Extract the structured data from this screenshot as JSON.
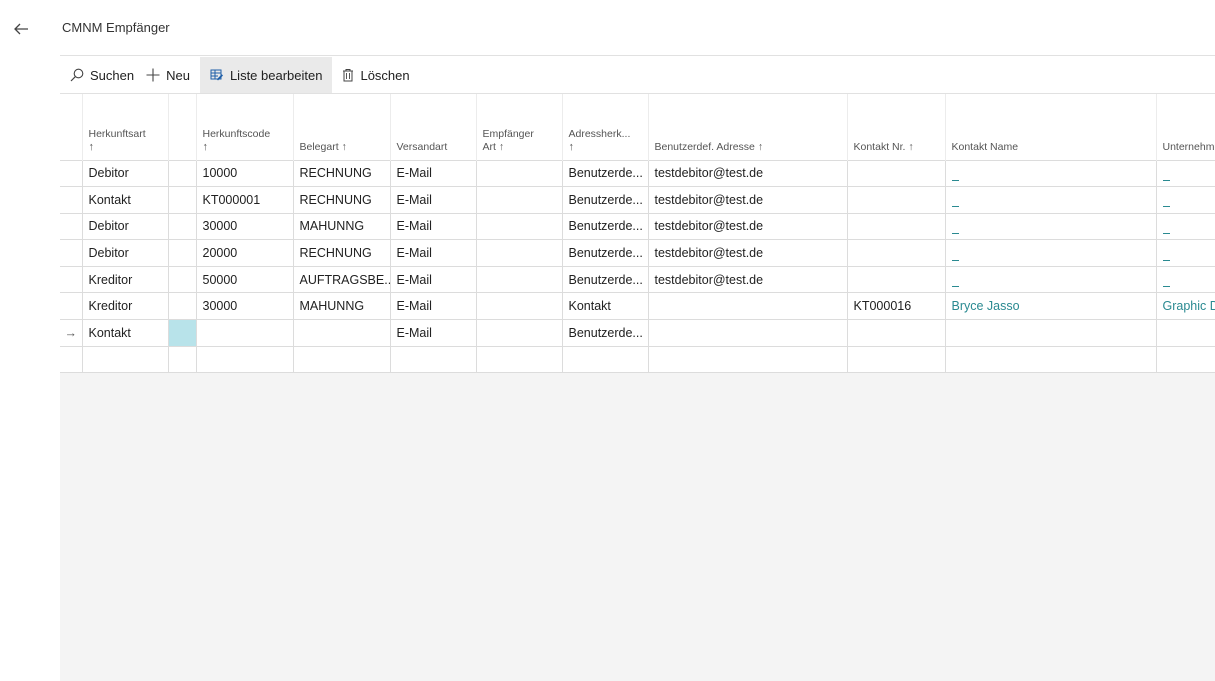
{
  "page": {
    "title": "CMNM Empfänger"
  },
  "toolbar": {
    "search_label": "Suchen",
    "new_label": "Neu",
    "edit_list_label": "Liste bearbeiten",
    "delete_label": "Löschen"
  },
  "columns": [
    {
      "line1": "Herkunftsart",
      "line2": "↑"
    },
    {
      "line1": "",
      "line2": ""
    },
    {
      "line1": "Herkunftscode",
      "line2": "↑"
    },
    {
      "line1": "",
      "line2": "Belegart ↑"
    },
    {
      "line1": "",
      "line2": "Versandart"
    },
    {
      "line1": "Empfänger",
      "line2": "Art ↑"
    },
    {
      "line1": "Adressherk...",
      "line2": "↑"
    },
    {
      "line1": "",
      "line2": "Benutzerdef. Adresse ↑"
    },
    {
      "line1": "",
      "line2": "Kontakt Nr. ↑"
    },
    {
      "line1": "",
      "line2": "Kontakt Name"
    },
    {
      "line1": "",
      "line2": "Unternehmen"
    }
  ],
  "rows": [
    {
      "indicator": "",
      "herkunftsart": "Debitor",
      "herkunftscode": "10000",
      "belegart": "RECHNUNG",
      "versandart": "E-Mail",
      "empfaenger_art": "",
      "adressherkunft": "Benutzerde...",
      "adresse": "testdebitor@test.de",
      "kontakt_nr": "",
      "kontakt_name": "_",
      "unternehmen": "_"
    },
    {
      "indicator": "",
      "herkunftsart": "Kontakt",
      "herkunftscode": "KT000001",
      "belegart": "RECHNUNG",
      "versandart": "E-Mail",
      "empfaenger_art": "",
      "adressherkunft": "Benutzerde...",
      "adresse": "testdebitor@test.de",
      "kontakt_nr": "",
      "kontakt_name": "_",
      "unternehmen": "_"
    },
    {
      "indicator": "",
      "herkunftsart": "Debitor",
      "herkunftscode": "30000",
      "belegart": "MAHUNNG",
      "versandart": "E-Mail",
      "empfaenger_art": "",
      "adressherkunft": "Benutzerde...",
      "adresse": "testdebitor@test.de",
      "kontakt_nr": "",
      "kontakt_name": "_",
      "unternehmen": "_"
    },
    {
      "indicator": "",
      "herkunftsart": "Debitor",
      "herkunftscode": "20000",
      "belegart": "RECHNUNG",
      "versandart": "E-Mail",
      "empfaenger_art": "",
      "adressherkunft": "Benutzerde...",
      "adresse": "testdebitor@test.de",
      "kontakt_nr": "",
      "kontakt_name": "_",
      "unternehmen": "_"
    },
    {
      "indicator": "",
      "herkunftsart": "Kreditor",
      "herkunftscode": "50000",
      "belegart": "AUFTRAGSBE...",
      "versandart": "E-Mail",
      "empfaenger_art": "",
      "adressherkunft": "Benutzerde...",
      "adresse": "testdebitor@test.de",
      "kontakt_nr": "",
      "kontakt_name": "_",
      "unternehmen": "_"
    },
    {
      "indicator": "",
      "herkunftsart": "Kreditor",
      "herkunftscode": "30000",
      "belegart": "MAHUNNG",
      "versandart": "E-Mail",
      "empfaenger_art": "",
      "adressherkunft": "Kontakt",
      "adresse": "",
      "kontakt_nr": "KT000016",
      "kontakt_name": "Bryce Jasso",
      "unternehmen": "Graphic Design"
    },
    {
      "indicator": "→",
      "herkunftsart": "Kontakt",
      "herkunftscode": "",
      "belegart": "",
      "versandart": "E-Mail",
      "empfaenger_art": "",
      "adressherkunft": "Benutzerde...",
      "adresse": "",
      "kontakt_nr": "",
      "kontakt_name": "",
      "unternehmen": ""
    },
    {
      "indicator": "",
      "herkunftsart": "",
      "herkunftscode": "",
      "belegart": "",
      "versandart": "",
      "empfaenger_art": "",
      "adressherkunft": "",
      "adresse": "",
      "kontakt_nr": "",
      "kontakt_name": "",
      "unternehmen": ""
    }
  ],
  "colors": {
    "link": "#2a8a91",
    "selected_cell": "#b8e3ea",
    "grid_background": "#f4f4f4"
  }
}
